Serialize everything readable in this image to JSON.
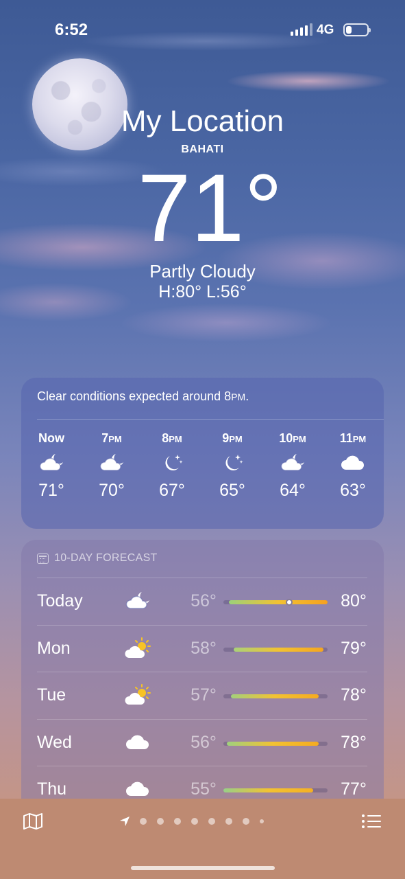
{
  "status_bar": {
    "time": "6:52",
    "network": "4G"
  },
  "header": {
    "location": "My Location",
    "sublocation": "BAHATI",
    "temperature": "71°",
    "condition": "Partly Cloudy",
    "high_low": "H:80°  L:56°"
  },
  "hourly": {
    "summary": "Clear conditions expected around 8",
    "summary_suffix": "PM",
    "summary_end": ".",
    "hours": [
      {
        "label": "Now",
        "label_suffix": "",
        "icon": "cloud-moon-icon",
        "temp": "71°"
      },
      {
        "label": "7",
        "label_suffix": "PM",
        "icon": "cloud-moon-icon",
        "temp": "70°"
      },
      {
        "label": "8",
        "label_suffix": "PM",
        "icon": "moon-stars-icon",
        "temp": "67°"
      },
      {
        "label": "9",
        "label_suffix": "PM",
        "icon": "moon-stars-icon",
        "temp": "65°"
      },
      {
        "label": "10",
        "label_suffix": "PM",
        "icon": "cloud-moon-icon",
        "temp": "64°"
      },
      {
        "label": "11",
        "label_suffix": "PM",
        "icon": "cloud-icon",
        "temp": "63°"
      }
    ]
  },
  "daily": {
    "title": "10-DAY FORECAST",
    "days": [
      {
        "name": "Today",
        "icon": "cloud-moon-icon",
        "low": "56°",
        "high": "80°",
        "range_start": 0.05,
        "range_end": 1.0,
        "current": 0.63,
        "colors": [
          "#9bd07a",
          "#f2c232",
          "#f5a11f"
        ]
      },
      {
        "name": "Mon",
        "icon": "cloud-sun-icon",
        "low": "58°",
        "high": "79°",
        "range_start": 0.1,
        "range_end": 0.96,
        "colors": [
          "#a9d17a",
          "#f2c232",
          "#f5a61f"
        ]
      },
      {
        "name": "Tue",
        "icon": "cloud-sun-icon",
        "low": "57°",
        "high": "78°",
        "range_start": 0.07,
        "range_end": 0.91,
        "colors": [
          "#a3d07c",
          "#f2c232",
          "#f5ab20"
        ]
      },
      {
        "name": "Wed",
        "icon": "cloud-icon",
        "low": "56°",
        "high": "78°",
        "range_start": 0.03,
        "range_end": 0.91,
        "colors": [
          "#9fd07e",
          "#f2c232",
          "#f5ab20"
        ]
      },
      {
        "name": "Thu",
        "icon": "cloud-icon",
        "low": "55°",
        "high": "77°",
        "range_start": 0.0,
        "range_end": 0.86,
        "colors": [
          "#98cf88",
          "#f2c232",
          "#f5b024"
        ]
      }
    ]
  },
  "bottom_bar": {
    "pages": 8
  }
}
